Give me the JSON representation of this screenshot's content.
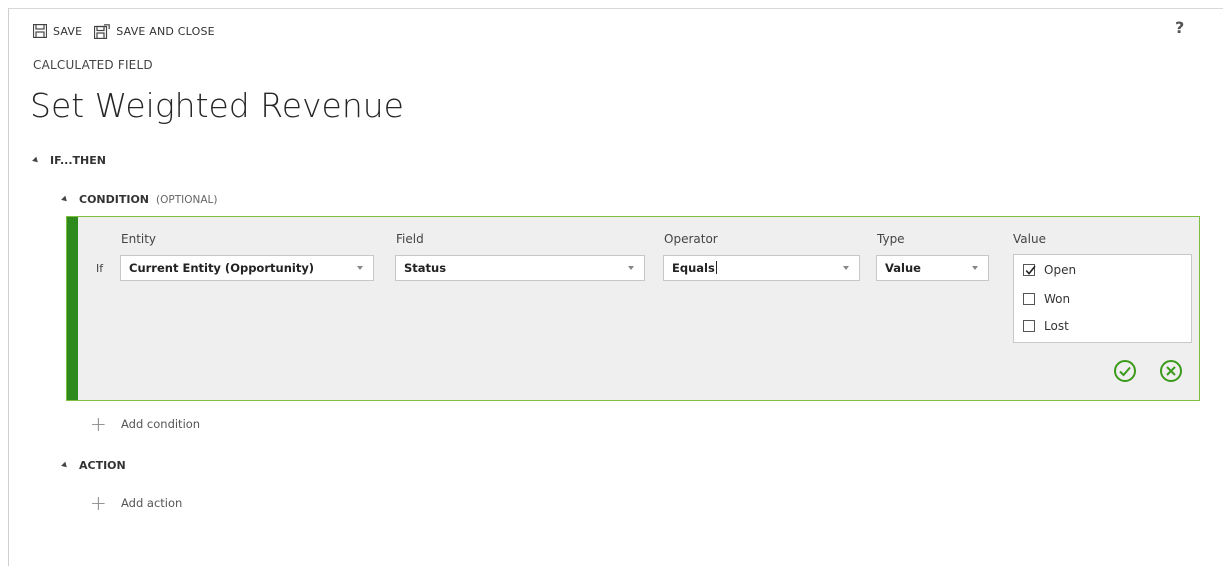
{
  "toolbar": {
    "save_label": "SAVE",
    "save_close_label": "SAVE AND CLOSE",
    "help_label": "?"
  },
  "header": {
    "subtitle": "CALCULATED FIELD",
    "title": "Set Weighted Revenue"
  },
  "if_then": {
    "label": "IF...THEN"
  },
  "condition": {
    "label": "CONDITION",
    "optional_label": "(OPTIONAL)",
    "row_prefix": "If",
    "columns": {
      "entity": "Entity",
      "field": "Field",
      "operator": "Operator",
      "type": "Type",
      "value": "Value"
    },
    "entity_value": "Current Entity (Opportunity)",
    "field_value": "Status",
    "operator_value": "Equals",
    "type_value": "Value",
    "value_options": [
      {
        "label": "Open",
        "checked": true
      },
      {
        "label": "Won",
        "checked": false
      },
      {
        "label": "Lost",
        "checked": false
      }
    ],
    "accent_color": "#2f8a1d",
    "confirm_color": "#3c9a1c"
  },
  "add_condition_label": "Add condition",
  "action": {
    "label": "ACTION"
  },
  "add_action_label": "Add action"
}
